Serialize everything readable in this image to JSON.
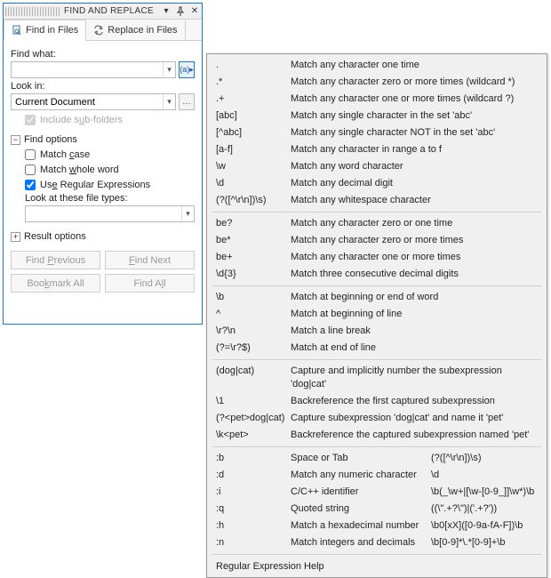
{
  "title": "FIND AND REPLACE",
  "tabs": {
    "find": "Find in Files",
    "replace": "Replace in Files"
  },
  "labels": {
    "findWhat": "Find what:",
    "lookIn": "Look in:",
    "includeSub": "Include sub-folders",
    "findOptions": "Find options",
    "matchCase": "Match case",
    "matchWhole": "Match whole word",
    "useRegex": "Use Regular Expressions",
    "lookTypes": "Look at these file types:",
    "resultOptions": "Result options"
  },
  "inputs": {
    "findWhat": "",
    "lookIn": "Current Document",
    "fileTypes": ""
  },
  "buttons": {
    "findPrev": "Find Previous",
    "findNext": "Find Next",
    "bookmarkAll": "Bookmark All",
    "findAll": "Find All"
  },
  "checks": {
    "includeSub": true,
    "matchCase": false,
    "matchWhole": false,
    "useRegex": true
  },
  "regex_help": {
    "g1": [
      {
        "p": ".",
        "d": "Match any character one time"
      },
      {
        "p": ".*",
        "d": "Match any character zero or more times (wildcard *)"
      },
      {
        "p": ".+",
        "d": "Match any character one or more times (wildcard ?)"
      },
      {
        "p": "[abc]",
        "d": "Match any single character in the set 'abc'"
      },
      {
        "p": "[^abc]",
        "d": "Match any single character NOT in the set 'abc'"
      },
      {
        "p": "[a-f]",
        "d": "Match any character in range a to f"
      },
      {
        "p": "\\w",
        "d": "Match any word character"
      },
      {
        "p": "\\d",
        "d": "Match any decimal digit"
      },
      {
        "p": "(?([^\\r\\n])\\s)",
        "d": "Match any whitespace character"
      }
    ],
    "g2": [
      {
        "p": "be?",
        "d": "Match any character zero or one time"
      },
      {
        "p": "be*",
        "d": "Match any character zero or more times"
      },
      {
        "p": "be+",
        "d": "Match any character one or more times"
      },
      {
        "p": "\\d{3}",
        "d": "Match three consecutive decimal digits"
      }
    ],
    "g3": [
      {
        "p": "\\b",
        "d": "Match at beginning or end of word"
      },
      {
        "p": "^",
        "d": "Match at beginning of line"
      },
      {
        "p": "\\r?\\n",
        "d": "Match a line break"
      },
      {
        "p": "(?=\\r?$)",
        "d": "Match at end of line"
      }
    ],
    "g4": [
      {
        "p": "(dog|cat)",
        "d": "Capture and implicitly number the subexpression 'dog|cat'"
      },
      {
        "p": "\\1",
        "d": "Backreference the first captured subexpression"
      },
      {
        "p": "(?<pet>dog|cat)",
        "d": "Capture subexpression 'dog|cat' and name it 'pet'"
      },
      {
        "p": "\\k<pet>",
        "d": "Backreference the captured subexpression named 'pet'"
      }
    ],
    "g5": [
      {
        "p": ":b",
        "d": "Space or Tab",
        "e": "(?([^\\r\\n])\\s)"
      },
      {
        "p": ":d",
        "d": "Match any numeric character",
        "e": "\\d"
      },
      {
        "p": ":i",
        "d": "C/C++ identifier",
        "e": "\\b(_\\w+|[\\w-[0-9_]]\\w*)\\b"
      },
      {
        "p": ":q",
        "d": "Quoted string",
        "e": "((\\\".+?\\\")|('.+?'))"
      },
      {
        "p": ":h",
        "d": "Match a hexadecimal number",
        "e": "\\b0[xX]([0-9a-fA-F])\\b"
      },
      {
        "p": ":n",
        "d": "Match integers and decimals",
        "e": "\\b[0-9]*\\.*[0-9]+\\b"
      }
    ],
    "footer": "Regular Expression Help"
  }
}
